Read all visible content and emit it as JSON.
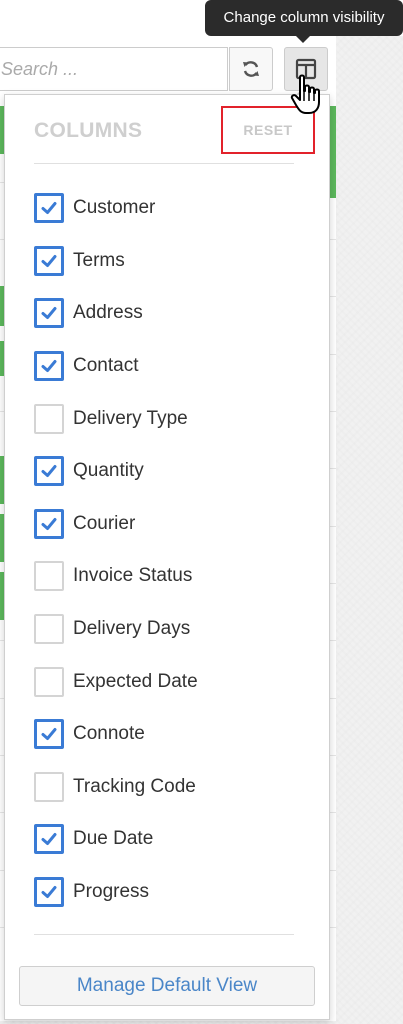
{
  "tooltip": {
    "text": "Change column visibility"
  },
  "search": {
    "placeholder": "Search ..."
  },
  "toolbar": {
    "refresh_icon": "refresh-icon",
    "columns_icon": "columns-icon"
  },
  "columns_panel": {
    "title": "COLUMNS",
    "reset_label": "RESET",
    "manage_label": "Manage Default View",
    "items": [
      {
        "label": "Customer",
        "checked": true
      },
      {
        "label": "Terms",
        "checked": true
      },
      {
        "label": "Address",
        "checked": true
      },
      {
        "label": "Contact",
        "checked": true
      },
      {
        "label": "Delivery Type",
        "checked": false
      },
      {
        "label": "Quantity",
        "checked": true
      },
      {
        "label": "Courier",
        "checked": true
      },
      {
        "label": "Invoice Status",
        "checked": false
      },
      {
        "label": "Delivery Days",
        "checked": false
      },
      {
        "label": "Expected Date",
        "checked": false
      },
      {
        "label": "Connote",
        "checked": true
      },
      {
        "label": "Tracking Code",
        "checked": false
      },
      {
        "label": "Due Date",
        "checked": true
      },
      {
        "label": "Progress",
        "checked": true
      }
    ]
  },
  "colors": {
    "accent": "#3a7bd5",
    "highlight_border": "#e2222b",
    "status_green": "#5cb85c"
  }
}
